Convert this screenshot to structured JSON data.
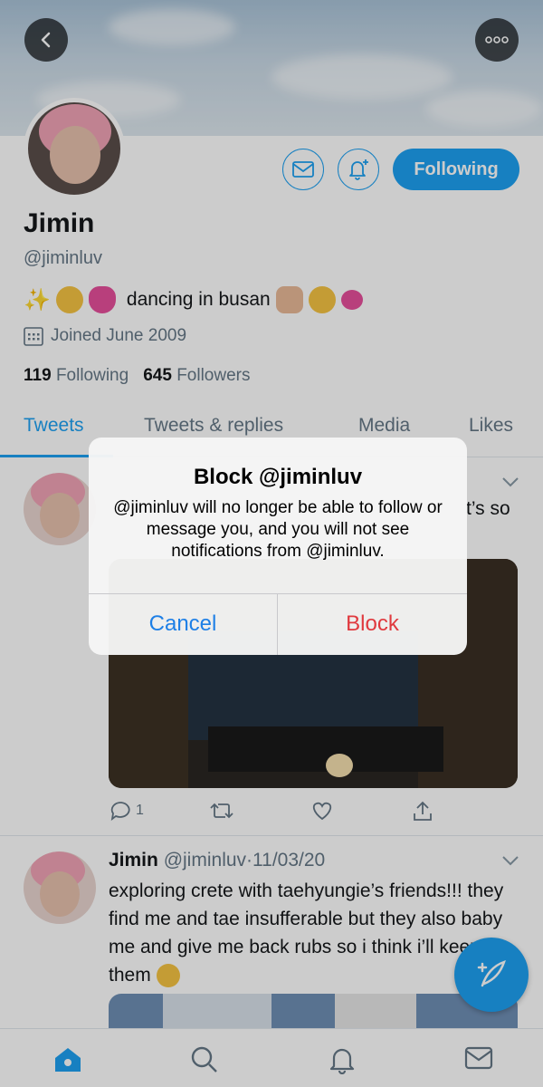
{
  "colors": {
    "accent": "#1da1f2",
    "destructive": "#e0393e",
    "secondary_text": "#657786"
  },
  "header": {
    "back_icon": "chevron-left-icon",
    "more_icon": "ellipsis-icon"
  },
  "profile": {
    "name": "Jimin",
    "handle": "@jiminluv",
    "bio_text": "dancing in busan",
    "joined": "Joined June 2009",
    "following_count": "119",
    "following_label": "Following",
    "followers_count": "645",
    "followers_label": "Followers",
    "follow_button_label": "Following",
    "message_icon": "envelope-icon",
    "notify_icon": "bell-plus-icon"
  },
  "tabs": [
    {
      "label": "Tweets",
      "active": true
    },
    {
      "label": "Tweets & replies",
      "active": false
    },
    {
      "label": "Media",
      "active": false
    },
    {
      "label": "Likes",
      "active": false
    }
  ],
  "tweet1": {
    "text_fragment": "t’s so",
    "reply_count": "1"
  },
  "tweet2": {
    "name": "Jimin",
    "handle": "@jiminluv",
    "separator": "·",
    "date": "11/03/20",
    "text": "exploring crete with taehyungie’s friends!!! they find me and tae insufferable but they also baby me and give me back rubs so i think i’ll keep them"
  },
  "dialog": {
    "title": "Block @jiminluv",
    "message": "@jiminluv  will no longer be able to follow or message you, and you will not see notifications from @jiminluv.",
    "cancel_label": "Cancel",
    "block_label": "Block"
  },
  "bottom_nav": [
    "home-icon",
    "search-icon",
    "notifications-icon",
    "messages-icon"
  ]
}
